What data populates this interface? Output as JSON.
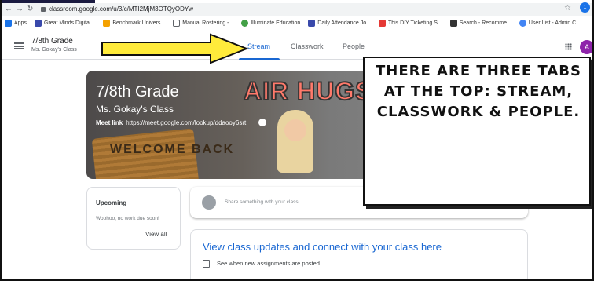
{
  "browser": {
    "url": "classroom.google.com/u/3/c/MTI2MjM3OTQyODYw",
    "profile_initial": "1",
    "bookmarks": [
      {
        "label": "Apps",
        "color": "#1a73e8",
        "icon": "apps-grid-icon"
      },
      {
        "label": "Great Minds Digital...",
        "color": "#3949ab",
        "icon": "bookmark-icon"
      },
      {
        "label": "Benchmark Univers...",
        "color": "#f4a100",
        "icon": "bookmark-icon"
      },
      {
        "label": "Manual Rostering -...",
        "color": "#5f6368",
        "icon": "document-icon"
      },
      {
        "label": "Illuminate Education",
        "color": "#43a047",
        "icon": "bookmark-icon"
      },
      {
        "label": "Daily Attendance Jo...",
        "color": "#3949ab",
        "icon": "bookmark-icon"
      },
      {
        "label": "This DIY Ticketing S...",
        "color": "#e53935",
        "icon": "bookmark-icon"
      },
      {
        "label": "Search - Recomme...",
        "color": "#333333",
        "icon": "bookmark-icon"
      },
      {
        "label": "User List - Admin C...",
        "color": "#4285f4",
        "icon": "google-g-icon"
      }
    ]
  },
  "header": {
    "class_name": "7/8th Grade",
    "teacher": "Ms. Gokay's Class",
    "tabs": [
      {
        "label": "Stream",
        "active": true
      },
      {
        "label": "Classwork",
        "active": false
      },
      {
        "label": "People",
        "active": false
      }
    ],
    "avatar_initial": "A"
  },
  "banner": {
    "title": "7/8th Grade",
    "subtitle": "Ms. Gokay's Class",
    "meet_label": "Meet link",
    "meet_url": "https://meet.google.com/lookup/ddaooy6srt",
    "image_text_top": "AIR HUGS",
    "image_text_bottom": "WELCOME BACK"
  },
  "upcoming": {
    "title": "Upcoming",
    "text": "Woohoo, no work due soon!",
    "link": "View all"
  },
  "share": {
    "placeholder": "Share something with your class..."
  },
  "updates": {
    "title": "View class updates and connect with your class here",
    "item": "See when new assignments are posted"
  },
  "annotation": {
    "text": "THERE ARE THREE TABS AT THE TOP: STREAM, CLASSWORK & PEOPLE.",
    "accent": "#ffeb3b"
  }
}
